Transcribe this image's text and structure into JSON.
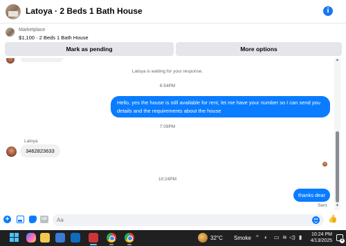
{
  "header": {
    "title": "Latoya · 2 Beds 1 Bath House",
    "info_icon": "i"
  },
  "listing": {
    "source": "Marketplace",
    "summary": "$1,100 · 2 Beds 1 Bath House"
  },
  "actions": {
    "mark_pending": "Mark as pending",
    "more_options": "More options"
  },
  "conversation": {
    "waiting_notice": "Latoya is waiting for your response.",
    "timestamps": [
      "6:54PM",
      "7:09PM",
      "10:24PM"
    ],
    "messages": [
      {
        "from": "me",
        "text": "Hello, yes the house is still available for rent, let me have your number so I can send you details and the requirements about the house"
      },
      {
        "from": "Latoya",
        "sender_label": "Latoya",
        "text": "3462823633"
      },
      {
        "from": "me",
        "text": "thanks dear",
        "status": "Sent"
      }
    ]
  },
  "composer": {
    "placeholder": "Aa",
    "gif_label": "GIF"
  },
  "taskbar": {
    "weather": {
      "temp": "32°C",
      "condition": "Smoke"
    },
    "time": "10:24 PM",
    "date": "4/13/2025",
    "notification_count": "2",
    "tray_icons": [
      "^",
      "◐",
      "▭",
      "≋",
      "◁)",
      "▮"
    ]
  },
  "colors": {
    "outgoing_bubble": "#0a7cff",
    "incoming_bubble": "#f0f0f0",
    "button_bg": "#e4e6eb",
    "taskbar_bg": "#202020"
  }
}
